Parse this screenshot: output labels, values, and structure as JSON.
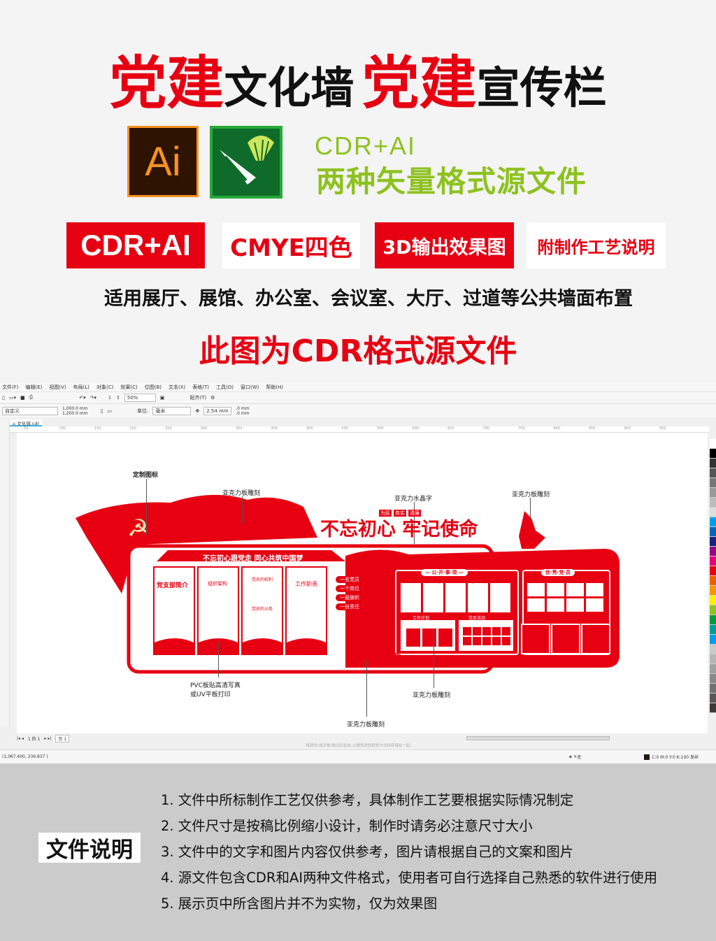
{
  "title": {
    "part1_red": "党建",
    "part1_black": "文化墙",
    "part2_red": "党建",
    "part2_black": "宣传栏"
  },
  "icons": {
    "ai": "Ai",
    "ai_name": "adobe-illustrator-icon",
    "cdr_name": "coreldraw-icon"
  },
  "formats": {
    "line1": "CDR+AI",
    "line2": "两种矢量格式源文件",
    "color": "#8dc21f"
  },
  "badges": [
    {
      "label": "CDR+AI",
      "style": "red"
    },
    {
      "label": "CMYE四色",
      "style": "white"
    },
    {
      "label": "3D输出效果图",
      "style": "red"
    },
    {
      "label": "附制作工艺说明",
      "style": "white"
    }
  ],
  "usage": "适用展厅、展馆、办公室、会议室、大厅、过道等公共墙面布置",
  "source_note": "此图为CDR格式源文件",
  "colors": {
    "red": "#e60012",
    "green": "#8dc21f",
    "gray": "#cbcbcb"
  },
  "app": {
    "menu": [
      "文件(F)",
      "编辑(E)",
      "视图(V)",
      "布局(L)",
      "对象(C)",
      "效果(C)",
      "位图(B)",
      "文本(X)",
      "表格(T)",
      "工具(O)",
      "窗口(W)",
      "帮助(H)"
    ],
    "zoom": "50%",
    "snap": "贴齐(T)",
    "page_preset": "自定义",
    "width": "1,000.0 mm",
    "height": "1,200.0 mm",
    "unit_label": "单位:",
    "unit": "毫米",
    "nudge": "2.54 mm",
    "dup_x": ".0 mm",
    "dup_y": ".0 mm",
    "doc_tab": "文化墙.cdr",
    "ruler": [
      "50",
      "100",
      "150",
      "200",
      "250",
      "300",
      "350",
      "400",
      "450",
      "500",
      "550",
      "600",
      "650",
      "700",
      "750",
      "800",
      "850",
      "900",
      "950"
    ],
    "page_nav": "1 的 1",
    "page_tab": "页 1",
    "hint": "将颜色(或对象)拖动至此处,以便将这些颜色与文档存储在一起",
    "coords": "(1,067.400, 239.837 )",
    "fill": "无",
    "outline": "C:0 M:0 Y:0 K:100  发丝"
  },
  "wall": {
    "labels": {
      "custom_logo": "定制图标",
      "acrylic_carve1": "亚克力板雕刻",
      "crystal": "亚克力水晶字",
      "acrylic_carve2": "亚克力板雕刻",
      "pvc": "PVC板贴高清写真",
      "pvc2": "或UV平板打印",
      "acrylic_carve3": "亚克力板雕刻",
      "acrylic_carve4": "亚克力板雕刻"
    },
    "slogan": "不忘初心 牢记使命",
    "tags": [
      "为民",
      "务实",
      "清廉"
    ],
    "banner": "不忘初心跟党走  同心共筑中国梦",
    "panels": [
      "党支部简介",
      "组织架构",
      "党员的权利",
      "工作职责"
    ],
    "panel3_sub": "党员的义务",
    "pills": [
      "一名党员",
      "一个岗位",
      "一面旗帜",
      "一份责任"
    ],
    "sec_public": "— 公·开·事·项 —",
    "sec_excellent": "优·秀·党·员",
    "sec_plan": "工作计划",
    "sec_activity": "党员活动"
  },
  "notes_title": "文件说明",
  "notes": [
    "1. 文件中所标制作工艺仅供参考，具体制作工艺要根据实际情况制定",
    "2. 文件尺寸是按稿比例缩小设计，制作时请务必注意尺寸大小",
    "3. 文件中的文字和图片内容仅供参考，图片请根据自己的文案和图片",
    "4. 源文件包含CDR和AI两种文件格式，使用者可自行选择自己熟悉的软件进行使用",
    "5. 展示页中所含图片并不为实物，仅为效果图"
  ]
}
